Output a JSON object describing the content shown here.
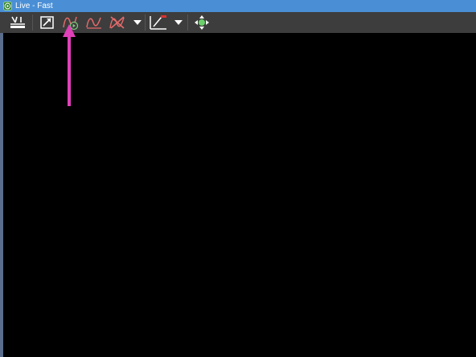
{
  "window": {
    "title": "Live - Fast"
  },
  "toolbar": {
    "buttons": [
      {
        "id": "baseline",
        "icon": "baseline-icon"
      },
      {
        "id": "export",
        "icon": "export-arrow-icon"
      },
      {
        "id": "live-curve",
        "icon": "curve-play-icon"
      },
      {
        "id": "curve",
        "icon": "curve-icon"
      },
      {
        "id": "remove-curve",
        "icon": "remove-curve-icon"
      },
      {
        "id": "axis-line",
        "icon": "axis-line-icon"
      },
      {
        "id": "pan",
        "icon": "pan-move-icon"
      }
    ]
  },
  "colors": {
    "titlebar": "#4a8fd6",
    "toolbar": "#3d3d3d",
    "canvas": "#000000",
    "annotation_arrow": "#e040b8"
  }
}
